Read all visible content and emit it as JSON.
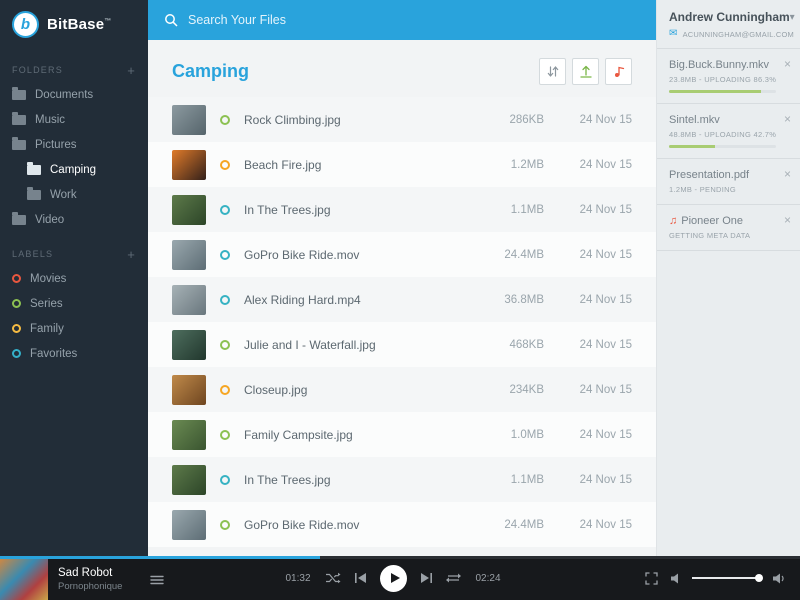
{
  "app": {
    "logo_text": "BitBase",
    "logo_tm": "™"
  },
  "icons": {
    "plus": "+",
    "close": "×",
    "chevron_down": "▾",
    "envelope": "✉",
    "music_note": "♫"
  },
  "search": {
    "placeholder": "Search Your Files"
  },
  "sidebar": {
    "folders_header": "FOLDERS",
    "labels_header": "LABELS",
    "folders": [
      {
        "label": "Documents",
        "indent": false,
        "active": false
      },
      {
        "label": "Music",
        "indent": false,
        "active": false
      },
      {
        "label": "Pictures",
        "indent": false,
        "active": false
      },
      {
        "label": "Camping",
        "indent": true,
        "active": true
      },
      {
        "label": "Work",
        "indent": true,
        "active": false
      },
      {
        "label": "Video",
        "indent": false,
        "active": false
      }
    ],
    "labels": [
      {
        "label": "Movies",
        "color": "#e9573f"
      },
      {
        "label": "Series",
        "color": "#8cc152"
      },
      {
        "label": "Family",
        "color": "#f6bb42"
      },
      {
        "label": "Favorites",
        "color": "#34b0c9"
      }
    ]
  },
  "main": {
    "title": "Camping",
    "files": [
      {
        "name": "Rock Climbing.jpg",
        "size": "286KB",
        "date": "24 Nov 15",
        "status_color": "#8cc152",
        "thumb": [
          "#8c9aa0",
          "#55646b"
        ]
      },
      {
        "name": "Beach Fire.jpg",
        "size": "1.2MB",
        "date": "24 Nov 15",
        "status_color": "#f6a623",
        "thumb": [
          "#e07b2a",
          "#33201a"
        ]
      },
      {
        "name": "In The Trees.jpg",
        "size": "1.1MB",
        "date": "24 Nov 15",
        "status_color": "#36b2c3",
        "thumb": [
          "#5d7a4a",
          "#2c4528"
        ]
      },
      {
        "name": "GoPro Bike Ride.mov",
        "size": "24.4MB",
        "date": "24 Nov 15",
        "status_color": "#36b2c3",
        "thumb": [
          "#9aa8ae",
          "#5d6d75"
        ]
      },
      {
        "name": "Alex Riding Hard.mp4",
        "size": "36.8MB",
        "date": "24 Nov 15",
        "status_color": "#36b2c3",
        "thumb": [
          "#a7b2b6",
          "#68767d"
        ]
      },
      {
        "name": "Julie and I - Waterfall.jpg",
        "size": "468KB",
        "date": "24 Nov 15",
        "status_color": "#8cc152",
        "thumb": [
          "#4e6e5e",
          "#21372d"
        ]
      },
      {
        "name": "Closeup.jpg",
        "size": "234KB",
        "date": "24 Nov 15",
        "status_color": "#f6a623",
        "thumb": [
          "#c08a4a",
          "#6e4520"
        ]
      },
      {
        "name": "Family Campsite.jpg",
        "size": "1.0MB",
        "date": "24 Nov 15",
        "status_color": "#8cc152",
        "thumb": [
          "#6a8a52",
          "#3a5530"
        ]
      },
      {
        "name": "In The Trees.jpg",
        "size": "1.1MB",
        "date": "24 Nov 15",
        "status_color": "#36b2c3",
        "thumb": [
          "#5d7a4a",
          "#2c4528"
        ]
      },
      {
        "name": "GoPro Bike Ride.mov",
        "size": "24.4MB",
        "date": "24 Nov 15",
        "status_color": "#8cc152",
        "thumb": [
          "#9aa8ae",
          "#5d6d75"
        ]
      }
    ]
  },
  "user": {
    "name": "Andrew Cunningham",
    "email": "ACUNNINGHAM@GMAIL.COM"
  },
  "uploads": [
    {
      "name": "Big.Buck.Bunny.mkv",
      "meta": "23.8MB - UPLOADING 86.3%",
      "progress": 86.3,
      "icon": null
    },
    {
      "name": "Sintel.mkv",
      "meta": "48.8MB - UPLOADING 42.7%",
      "progress": 42.7,
      "icon": null
    },
    {
      "name": "Presentation.pdf",
      "meta": "1.2MB - PENDING",
      "progress": null,
      "icon": null
    },
    {
      "name": "Pioneer One",
      "meta": "GETTING META DATA",
      "progress": null,
      "icon": "music"
    }
  ],
  "player": {
    "track": "Sad Robot",
    "artist": "Pornophonique",
    "elapsed": "01:32",
    "duration": "02:24",
    "progress_percent": 40
  },
  "colors": {
    "accent_blue": "#29a3dc",
    "upload_green": "#a8cc72",
    "alert_red": "#e9573f"
  }
}
